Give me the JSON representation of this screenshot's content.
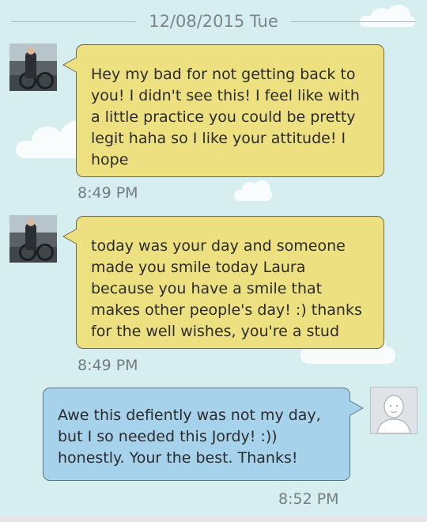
{
  "chat": {
    "date_separator": "12/08/2015 Tue",
    "messages": [
      {
        "direction": "incoming",
        "text": "Hey my bad for not getting back to you! I didn't see this! I feel like with a little practice you could be pretty legit haha so I like your attitude! I hope",
        "time": "8:49 PM"
      },
      {
        "direction": "incoming",
        "text": "today was your day and someone made you smile today Laura because you have a smile that makes other people's day! :) thanks for the well wishes, you're a stud",
        "time": "8:49 PM"
      },
      {
        "direction": "outgoing",
        "text": "Awe this defiently was not my day, but I so needed this Jordy! :)) honestly. Your the best. Thanks!",
        "time": "8:52 PM"
      }
    ]
  },
  "colors": {
    "background": "#d6eef0",
    "incoming_bubble": "#ede081",
    "outgoing_bubble": "#a7d2eb"
  }
}
